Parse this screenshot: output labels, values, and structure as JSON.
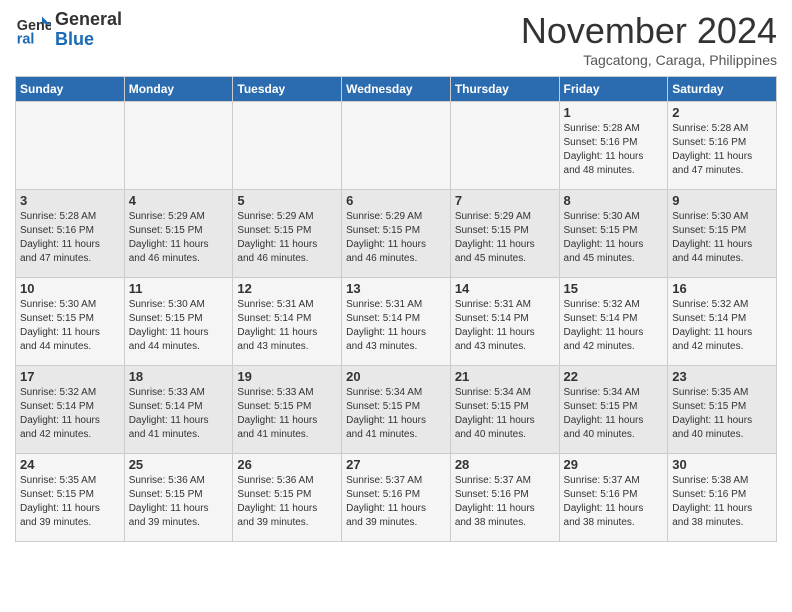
{
  "header": {
    "logo_line1": "General",
    "logo_line2": "Blue",
    "month": "November 2024",
    "location": "Tagcatong, Caraga, Philippines"
  },
  "days_of_week": [
    "Sunday",
    "Monday",
    "Tuesday",
    "Wednesday",
    "Thursday",
    "Friday",
    "Saturday"
  ],
  "weeks": [
    [
      {
        "day": "",
        "info": ""
      },
      {
        "day": "",
        "info": ""
      },
      {
        "day": "",
        "info": ""
      },
      {
        "day": "",
        "info": ""
      },
      {
        "day": "",
        "info": ""
      },
      {
        "day": "1",
        "info": "Sunrise: 5:28 AM\nSunset: 5:16 PM\nDaylight: 11 hours\nand 48 minutes."
      },
      {
        "day": "2",
        "info": "Sunrise: 5:28 AM\nSunset: 5:16 PM\nDaylight: 11 hours\nand 47 minutes."
      }
    ],
    [
      {
        "day": "3",
        "info": "Sunrise: 5:28 AM\nSunset: 5:16 PM\nDaylight: 11 hours\nand 47 minutes."
      },
      {
        "day": "4",
        "info": "Sunrise: 5:29 AM\nSunset: 5:15 PM\nDaylight: 11 hours\nand 46 minutes."
      },
      {
        "day": "5",
        "info": "Sunrise: 5:29 AM\nSunset: 5:15 PM\nDaylight: 11 hours\nand 46 minutes."
      },
      {
        "day": "6",
        "info": "Sunrise: 5:29 AM\nSunset: 5:15 PM\nDaylight: 11 hours\nand 46 minutes."
      },
      {
        "day": "7",
        "info": "Sunrise: 5:29 AM\nSunset: 5:15 PM\nDaylight: 11 hours\nand 45 minutes."
      },
      {
        "day": "8",
        "info": "Sunrise: 5:30 AM\nSunset: 5:15 PM\nDaylight: 11 hours\nand 45 minutes."
      },
      {
        "day": "9",
        "info": "Sunrise: 5:30 AM\nSunset: 5:15 PM\nDaylight: 11 hours\nand 44 minutes."
      }
    ],
    [
      {
        "day": "10",
        "info": "Sunrise: 5:30 AM\nSunset: 5:15 PM\nDaylight: 11 hours\nand 44 minutes."
      },
      {
        "day": "11",
        "info": "Sunrise: 5:30 AM\nSunset: 5:15 PM\nDaylight: 11 hours\nand 44 minutes."
      },
      {
        "day": "12",
        "info": "Sunrise: 5:31 AM\nSunset: 5:14 PM\nDaylight: 11 hours\nand 43 minutes."
      },
      {
        "day": "13",
        "info": "Sunrise: 5:31 AM\nSunset: 5:14 PM\nDaylight: 11 hours\nand 43 minutes."
      },
      {
        "day": "14",
        "info": "Sunrise: 5:31 AM\nSunset: 5:14 PM\nDaylight: 11 hours\nand 43 minutes."
      },
      {
        "day": "15",
        "info": "Sunrise: 5:32 AM\nSunset: 5:14 PM\nDaylight: 11 hours\nand 42 minutes."
      },
      {
        "day": "16",
        "info": "Sunrise: 5:32 AM\nSunset: 5:14 PM\nDaylight: 11 hours\nand 42 minutes."
      }
    ],
    [
      {
        "day": "17",
        "info": "Sunrise: 5:32 AM\nSunset: 5:14 PM\nDaylight: 11 hours\nand 42 minutes."
      },
      {
        "day": "18",
        "info": "Sunrise: 5:33 AM\nSunset: 5:14 PM\nDaylight: 11 hours\nand 41 minutes."
      },
      {
        "day": "19",
        "info": "Sunrise: 5:33 AM\nSunset: 5:15 PM\nDaylight: 11 hours\nand 41 minutes."
      },
      {
        "day": "20",
        "info": "Sunrise: 5:34 AM\nSunset: 5:15 PM\nDaylight: 11 hours\nand 41 minutes."
      },
      {
        "day": "21",
        "info": "Sunrise: 5:34 AM\nSunset: 5:15 PM\nDaylight: 11 hours\nand 40 minutes."
      },
      {
        "day": "22",
        "info": "Sunrise: 5:34 AM\nSunset: 5:15 PM\nDaylight: 11 hours\nand 40 minutes."
      },
      {
        "day": "23",
        "info": "Sunrise: 5:35 AM\nSunset: 5:15 PM\nDaylight: 11 hours\nand 40 minutes."
      }
    ],
    [
      {
        "day": "24",
        "info": "Sunrise: 5:35 AM\nSunset: 5:15 PM\nDaylight: 11 hours\nand 39 minutes."
      },
      {
        "day": "25",
        "info": "Sunrise: 5:36 AM\nSunset: 5:15 PM\nDaylight: 11 hours\nand 39 minutes."
      },
      {
        "day": "26",
        "info": "Sunrise: 5:36 AM\nSunset: 5:15 PM\nDaylight: 11 hours\nand 39 minutes."
      },
      {
        "day": "27",
        "info": "Sunrise: 5:37 AM\nSunset: 5:16 PM\nDaylight: 11 hours\nand 39 minutes."
      },
      {
        "day": "28",
        "info": "Sunrise: 5:37 AM\nSunset: 5:16 PM\nDaylight: 11 hours\nand 38 minutes."
      },
      {
        "day": "29",
        "info": "Sunrise: 5:37 AM\nSunset: 5:16 PM\nDaylight: 11 hours\nand 38 minutes."
      },
      {
        "day": "30",
        "info": "Sunrise: 5:38 AM\nSunset: 5:16 PM\nDaylight: 11 hours\nand 38 minutes."
      }
    ]
  ]
}
